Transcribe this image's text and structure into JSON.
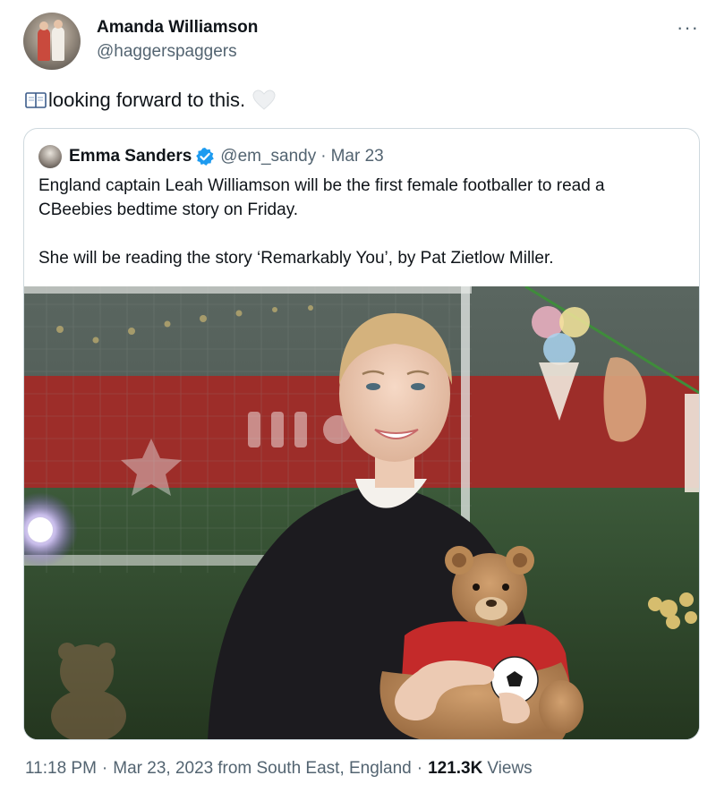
{
  "tweet": {
    "author_name": "Amanda Williamson",
    "author_handle": "@haggerspaggers",
    "more_icon": "ellipsis-icon",
    "text": "looking forward to this.",
    "leading_emoji": "open-book-icon",
    "trailing_emoji": "white-heart-icon",
    "footer": {
      "time": "11:18 PM",
      "date": "Mar 23, 2023",
      "location": "from South East, England",
      "views_count": "121.3K",
      "views_label": "Views",
      "separator": "·"
    }
  },
  "quote": {
    "author_name": "Emma Sanders",
    "verified_icon": "verified-badge-icon",
    "handle": "@em_sandy",
    "separator": "·",
    "date": "Mar 23",
    "paragraphs": [
      "England captain Leah Williamson will be the first female footballer to read a CBeebies bedtime story on Friday.",
      "She will be reading the story ‘Remarkably You’, by Pat Zietlow Miller."
    ]
  },
  "colors": {
    "text_primary": "#0f1419",
    "text_secondary": "#536471",
    "border": "#cfd9de",
    "verified": "#1d9bf0"
  }
}
